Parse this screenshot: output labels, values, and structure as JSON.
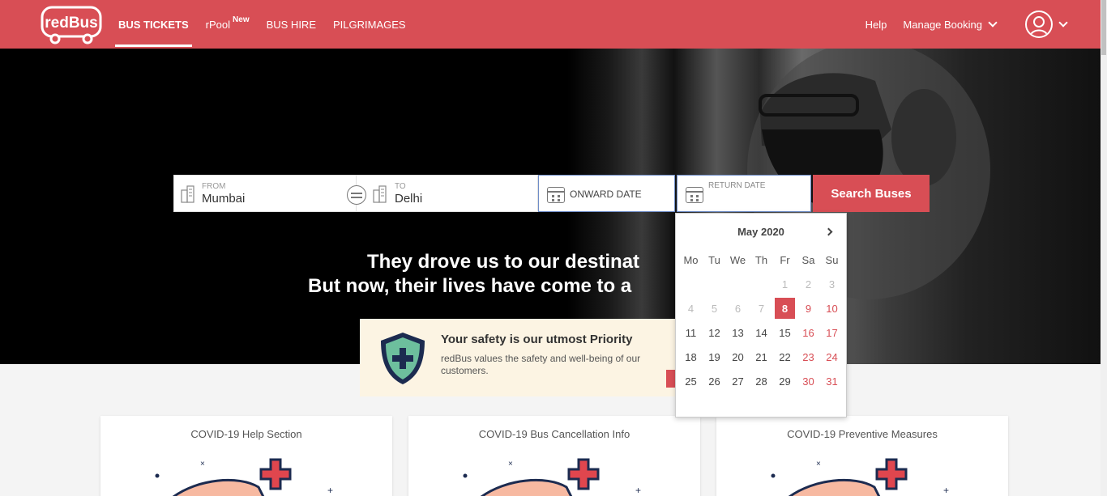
{
  "header": {
    "logo": "redBus",
    "nav": [
      {
        "label": "BUS TICKETS",
        "badge": ""
      },
      {
        "label": "rPool",
        "badge": "New"
      },
      {
        "label": "BUS HIRE",
        "badge": ""
      },
      {
        "label": "PILGRIMAGES",
        "badge": ""
      }
    ],
    "help": "Help",
    "manage_booking": "Manage Booking"
  },
  "search": {
    "from_label": "FROM",
    "from_value": "Mumbai",
    "to_label": "TO",
    "to_value": "Delhi",
    "onward_label": "ONWARD DATE",
    "return_label": "RETURN DATE",
    "button": "Search Buses"
  },
  "hero": {
    "line1": "They drove us to our destinat",
    "line2": "But now, their lives have come to a"
  },
  "safety": {
    "title": "Your safety is our utmost Priority",
    "desc": "redBus values the safety and well-being of our customers."
  },
  "cards": [
    {
      "title": "COVID-19 Help Section"
    },
    {
      "title": "COVID-19 Bus Cancellation Info"
    },
    {
      "title": "COVID-19 Preventive Measures"
    }
  ],
  "calendar": {
    "month": "May 2020",
    "weekdays": [
      "Mo",
      "Tu",
      "We",
      "Th",
      "Fr",
      "Sa",
      "Su"
    ],
    "days": [
      {
        "d": "",
        "s": ""
      },
      {
        "d": "",
        "s": ""
      },
      {
        "d": "",
        "s": ""
      },
      {
        "d": "",
        "s": ""
      },
      {
        "d": "1",
        "s": "past"
      },
      {
        "d": "2",
        "s": "past"
      },
      {
        "d": "3",
        "s": "past"
      },
      {
        "d": "4",
        "s": "past"
      },
      {
        "d": "5",
        "s": "past"
      },
      {
        "d": "6",
        "s": "past"
      },
      {
        "d": "7",
        "s": "past"
      },
      {
        "d": "8",
        "s": "sel"
      },
      {
        "d": "9",
        "s": "weekend"
      },
      {
        "d": "10",
        "s": "weekend"
      },
      {
        "d": "11",
        "s": ""
      },
      {
        "d": "12",
        "s": ""
      },
      {
        "d": "13",
        "s": ""
      },
      {
        "d": "14",
        "s": ""
      },
      {
        "d": "15",
        "s": ""
      },
      {
        "d": "16",
        "s": "weekend"
      },
      {
        "d": "17",
        "s": "weekend"
      },
      {
        "d": "18",
        "s": ""
      },
      {
        "d": "19",
        "s": ""
      },
      {
        "d": "20",
        "s": ""
      },
      {
        "d": "21",
        "s": ""
      },
      {
        "d": "22",
        "s": ""
      },
      {
        "d": "23",
        "s": "weekend"
      },
      {
        "d": "24",
        "s": "weekend"
      },
      {
        "d": "25",
        "s": ""
      },
      {
        "d": "26",
        "s": ""
      },
      {
        "d": "27",
        "s": ""
      },
      {
        "d": "28",
        "s": ""
      },
      {
        "d": "29",
        "s": ""
      },
      {
        "d": "30",
        "s": "weekend"
      },
      {
        "d": "31",
        "s": "weekend"
      }
    ]
  },
  "colors": {
    "brand": "#d84e55",
    "safety_bg": "#fcf4e3"
  }
}
